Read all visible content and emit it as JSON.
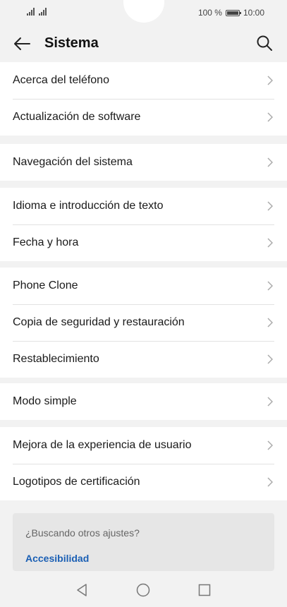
{
  "status_bar": {
    "battery": "100 %",
    "time": "10:00",
    "battery_level": 1.0
  },
  "header": {
    "title": "Sistema",
    "back_icon": "arrow-left-icon",
    "search_icon": "search-icon"
  },
  "groups": [
    [
      "Acerca del teléfono",
      "Actualización de software"
    ],
    [
      "Navegación del sistema"
    ],
    [
      "Idioma e introducción de texto",
      "Fecha y hora"
    ],
    [
      "Phone Clone",
      "Copia de seguridad y restauración",
      "Restablecimiento"
    ],
    [
      "Modo simple"
    ],
    [
      "Mejora de la experiencia de usuario",
      "Logotipos de certificación"
    ]
  ],
  "suggestion": {
    "question": "¿Buscando otros ajustes?",
    "link": "Accesibilidad"
  },
  "colors": {
    "background": "#f2f2f2",
    "accent": "#1a5fb4"
  },
  "nav": {
    "back": "triangle-back-icon",
    "home": "circle-home-icon",
    "recents": "square-recents-icon"
  }
}
